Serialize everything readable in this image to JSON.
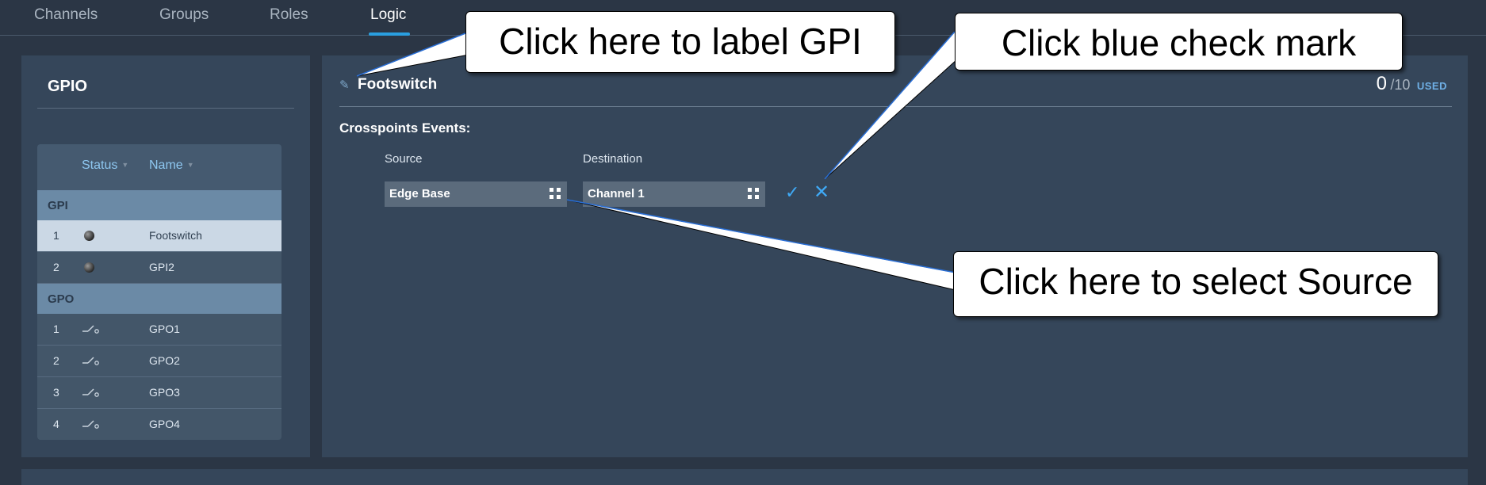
{
  "nav": {
    "tabs": [
      {
        "label": "Channels",
        "active": false
      },
      {
        "label": "Groups",
        "active": false
      },
      {
        "label": "Roles",
        "active": false
      },
      {
        "label": "Logic",
        "active": true
      }
    ]
  },
  "gpio_panel": {
    "title": "GPIO",
    "columns": {
      "status": "Status",
      "name": "Name"
    },
    "gpi_group": "GPI",
    "gpo_group": "GPO",
    "gpi_rows": [
      {
        "index": "1",
        "name": "Footswitch",
        "selected": true,
        "status_icon": "led-indicator-icon"
      },
      {
        "index": "2",
        "name": "GPI2",
        "selected": false,
        "status_icon": "led-indicator-icon"
      }
    ],
    "gpo_rows": [
      {
        "index": "1",
        "name": "GPO1",
        "status_icon": "switch-icon"
      },
      {
        "index": "2",
        "name": "GPO2",
        "status_icon": "switch-icon"
      },
      {
        "index": "3",
        "name": "GPO3",
        "status_icon": "switch-icon"
      },
      {
        "index": "4",
        "name": "GPO4",
        "status_icon": "switch-icon"
      }
    ]
  },
  "main_panel": {
    "title": "Footswitch",
    "edit_icon": "pencil-icon",
    "used_count": "0",
    "used_total": "/10",
    "used_label": "USED",
    "section_label": "Crosspoints Events:",
    "source_label": "Source",
    "destination_label": "Destination",
    "source_value": "Edge Base",
    "destination_value": "Channel 1",
    "confirm_icon": "check-icon",
    "cancel_icon": "close-icon"
  },
  "callouts": {
    "label_gpi": "Click here to label GPI",
    "check_mark": "Click blue check mark",
    "select_source": "Click here to select Source"
  },
  "colors": {
    "background": "#2b3645",
    "panel": "#35465a",
    "accent": "#2a9fe0",
    "selected_row": "#cbd8e5",
    "group_header": "#6b8aa6"
  }
}
